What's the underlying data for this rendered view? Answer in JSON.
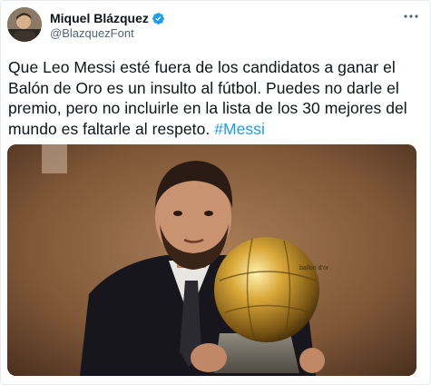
{
  "author": {
    "name": "Miquel Blázquez",
    "handle": "@BlazquezFont"
  },
  "tweet": {
    "text": "Que Leo Messi esté fuera de los candidatos a ganar el Balón de Oro es un insulto al fútbol. Puedes no darle el premio, pero no incluirle en la lista de los 30 mejores del mundo es faltarle al respeto.",
    "hashtag": "#Messi"
  },
  "media": {
    "trophy_text": "ballon d'or"
  },
  "icons": {
    "verified": "verified-badge-icon",
    "more": "more-options-icon"
  },
  "colors": {
    "accent": "#1d9bf0",
    "text": "#0f1419",
    "muted": "#536471"
  }
}
